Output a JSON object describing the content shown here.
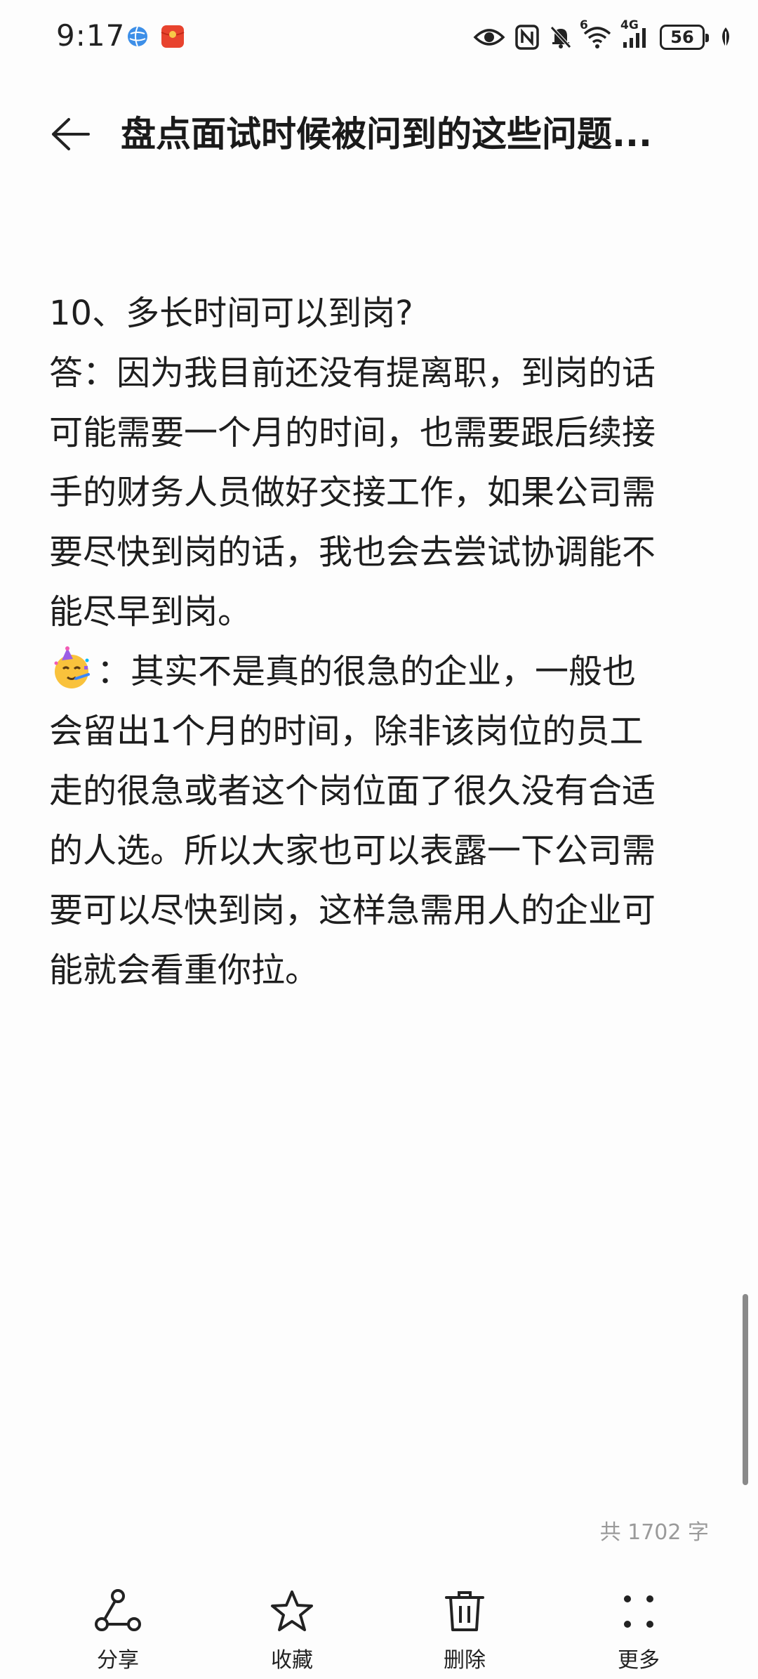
{
  "status_bar": {
    "time": "9:17",
    "network_label": "4G",
    "wifi_label": "6",
    "battery": "56"
  },
  "header": {
    "title": "盘点面试时候被问到的这些问题..."
  },
  "note": {
    "lines": [
      "10、多长时间可以到岗?",
      "答：因为我目前还没有提离职，到岗的话",
      "可能需要一个月的时间，也需要跟后续接",
      "手的财务人员做好交接工作，如果公司需",
      "要尽快到岗的话，我也会去尝试协调能不",
      "能尽早到岗。",
      "：其实不是真的很急的企业，一般也",
      "会留出1个月的时间，除非该岗位的员工",
      "走的很急或者这个岗位面了很久没有合适",
      "的人选。所以大家也可以表露一下公司需",
      "要可以尽快到岗，这样急需用人的企业可",
      "能就会看重你拉。"
    ],
    "emoji_icon": "party-face-icon"
  },
  "word_count": "共 1702 字",
  "toolbar": {
    "share_label": "分享",
    "favorite_label": "收藏",
    "delete_label": "删除",
    "more_label": "更多"
  },
  "colors": {
    "background": "#fdfdfd",
    "text": "#1e1e1e",
    "muted": "#9a9a9a",
    "scrollbar": "#8a8a8a",
    "badge_red": "#e8432e",
    "browser_blue": "#3d8fe8"
  }
}
